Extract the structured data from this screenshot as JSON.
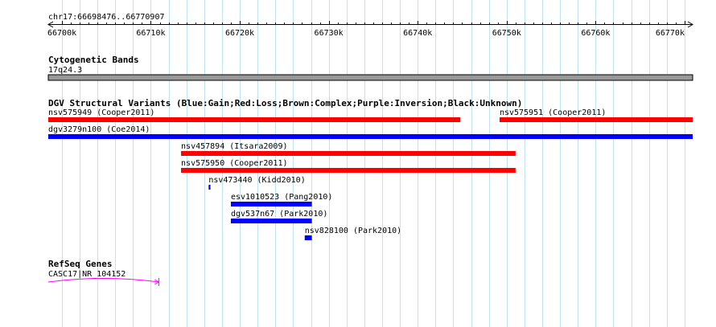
{
  "region": "chr17:66698476..66770907",
  "ruler": {
    "start": 66700000,
    "end": 66770000,
    "ticks": [
      "66700k",
      "66710k",
      "66720k",
      "66730k",
      "66740k",
      "66750k",
      "66760k",
      "66770k"
    ]
  },
  "tracks": {
    "cyto": {
      "title": "Cytogenetic Bands",
      "band": "17q24.3",
      "color": "#999999"
    },
    "dgv": {
      "title": "DGV Structural Variants (Blue:Gain;Red:Loss;Brown:Complex;Purple:Inversion;Black:Unknown)",
      "features": [
        {
          "label": "nsv575949 (Cooper2011)",
          "start": 66698476,
          "end": 66744800,
          "color": "#ff0000",
          "row": 0
        },
        {
          "label": "nsv575951 (Cooper2011)",
          "start": 66749200,
          "end": 66770907,
          "color": "#ff0000",
          "row": 0
        },
        {
          "label": "dgv3279n100 (Coe2014)",
          "start": 66698476,
          "end": 66770907,
          "color": "#0000ff",
          "row": 1
        },
        {
          "label": "nsv457894 (Itsara2009)",
          "start": 66713400,
          "end": 66751000,
          "color": "#ff0000",
          "row": 2
        },
        {
          "label": "nsv575950 (Cooper2011)",
          "start": 66713400,
          "end": 66751000,
          "color": "#ff0000",
          "row": 3
        },
        {
          "label": "nsv473440 (Kidd2010)",
          "start": 66716500,
          "end": 66716700,
          "color": "#0000ff",
          "row": 4
        },
        {
          "label": "esv1010523 (Pang2010)",
          "start": 66719000,
          "end": 66728100,
          "color": "#0000ff",
          "row": 5
        },
        {
          "label": "dgv537n67 (Park2010)",
          "start": 66719000,
          "end": 66728100,
          "color": "#0000ff",
          "row": 6
        },
        {
          "label": "nsv828100 (Park2010)",
          "start": 66727300,
          "end": 66728100,
          "color": "#0000ff",
          "row": 7
        }
      ]
    },
    "refseq": {
      "title": "RefSeq Genes",
      "genes": [
        {
          "label": "CASC17|NR_104152",
          "start": 66698476,
          "end": 66710900,
          "color": "#ff00ff"
        }
      ]
    }
  }
}
